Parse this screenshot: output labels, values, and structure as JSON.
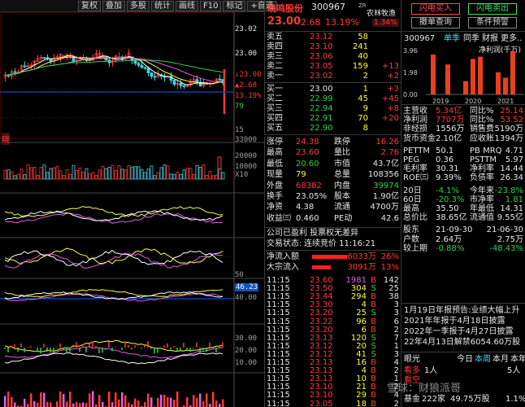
{
  "toolbar": {
    "buttons": [
      "复权",
      "叠加",
      "多股",
      "统计",
      "画线",
      "F10",
      "标记"
    ],
    "auto_label": "+自选"
  },
  "chart": {
    "axis_labels": [
      "23.02",
      "23.00",
      "13.19%",
      "79",
      "15",
      "33000",
      "20000",
      "10000",
      "X10",
      "50",
      "46.23",
      "40.00",
      "30.00",
      "20.00",
      "10.00"
    ],
    "price_marker": "↓23.00",
    "chg_marker": "▲2.68",
    "side_label": "晓"
  },
  "stock": {
    "name": "晓鸣股份",
    "code": "300967",
    "tag": "ZR",
    "sector": "农林牧渔",
    "sector_pct": "1.34%",
    "price": "23.00",
    "change": "2.68",
    "change_pct": "13.19%"
  },
  "order_book": {
    "asks": [
      {
        "label": "卖五",
        "price": "23.12",
        "vol": "58",
        "chg": ""
      },
      {
        "label": "卖四",
        "price": "23.10",
        "vol": "241",
        "chg": ""
      },
      {
        "label": "卖三",
        "price": "23.06",
        "vol": "40",
        "chg": ""
      },
      {
        "label": "卖二",
        "price": "23.05",
        "vol": "159",
        "chg": "+13"
      },
      {
        "label": "卖一",
        "price": "23.02",
        "vol": "2",
        "chg": "+2"
      }
    ],
    "bids": [
      {
        "label": "买一",
        "price": "23.00",
        "vol": "1",
        "chg": "+3"
      },
      {
        "label": "买二",
        "price": "22.99",
        "vol": "45",
        "chg": "+45"
      },
      {
        "label": "买三",
        "price": "22.94",
        "vol": "9",
        "chg": "+8"
      },
      {
        "label": "买四",
        "price": "22.91",
        "vol": "70",
        "chg": "+20"
      },
      {
        "label": "买五",
        "price": "22.90",
        "vol": "8",
        "chg": ""
      }
    ]
  },
  "quote_stats": [
    [
      "涨停",
      "24.38",
      "跌停",
      "16.26"
    ],
    [
      "最高",
      "23.60",
      "量比",
      "2.76"
    ],
    [
      "最低",
      "20.60",
      "市值",
      "43.7亿"
    ],
    [
      "现量",
      "79",
      "总量",
      "108356"
    ],
    [
      "外盘",
      "68382",
      "内盘",
      "39974"
    ],
    [
      "换手",
      "23.05%",
      "股本",
      "1.90亿"
    ],
    [
      "净资",
      "4.38",
      "流通",
      "4700万"
    ],
    [
      "收益㈢",
      "0.460",
      "PE动",
      "42.6"
    ]
  ],
  "status": {
    "line1": "公司已盈利 投票权无差异",
    "line2_label": "交易状态:",
    "line2_value": "连续竞价 11:16:21"
  },
  "flows": [
    {
      "label": "净流入额",
      "value": "6033万",
      "pct": "26%",
      "bar": 0.85
    },
    {
      "label": "大宗流入",
      "value": "3091万",
      "pct": "13%",
      "bar": 0.45
    }
  ],
  "ticks": [
    {
      "time": "11:15",
      "price": "23.60",
      "vol": "1981",
      "dir": "B",
      "n": "142"
    },
    {
      "time": "11:15",
      "price": "23.50",
      "vol": "304",
      "dir": "S",
      "n": "25"
    },
    {
      "time": "11:15",
      "price": "23.44",
      "vol": "294",
      "dir": "B",
      "n": "38"
    },
    {
      "time": "11:15",
      "price": "23.30",
      "vol": "4",
      "dir": "B",
      "n": "3"
    },
    {
      "time": "11:15",
      "price": "23.20",
      "vol": "25",
      "dir": "S",
      "n": "3"
    },
    {
      "time": "11:15",
      "price": "23.22",
      "vol": "96",
      "dir": "B",
      "n": "6"
    },
    {
      "time": "11:15",
      "price": "23.20",
      "vol": "6",
      "dir": "B",
      "n": "2"
    },
    {
      "time": "11:15",
      "price": "23.13",
      "vol": "120",
      "dir": "S",
      "n": "7"
    },
    {
      "time": "11:15",
      "price": "23.12",
      "vol": "20",
      "dir": "S",
      "n": "1"
    },
    {
      "time": "11:15",
      "price": "23.12",
      "vol": "41",
      "dir": "S",
      "n": "3"
    },
    {
      "time": "11:15",
      "price": "23.13",
      "vol": "16",
      "dir": "B",
      "n": "4"
    },
    {
      "time": "11:15",
      "price": "23.13",
      "vol": "4",
      "dir": "B",
      "n": "2"
    },
    {
      "time": "11:15",
      "price": "23.13",
      "vol": "10",
      "dir": "B",
      "n": "1"
    },
    {
      "time": "11:15",
      "price": "23.10",
      "vol": "21",
      "dir": "B",
      "n": "2"
    },
    {
      "time": "11:15",
      "price": "23.10",
      "vol": "29",
      "dir": "B",
      "n": "4"
    },
    {
      "time": "11:15",
      "price": "23.05",
      "vol": "18",
      "dir": "B",
      "n": "2"
    }
  ],
  "right": {
    "buttons": {
      "buy": "闪电买入",
      "sell": "闪电卖出",
      "cancel": "撤单查询",
      "cond": "条件预警"
    },
    "code": "300967",
    "tabs": [
      "单季",
      "同季",
      "财报",
      "更多.."
    ],
    "chart_title": "净利润(千万)",
    "fundamentals": [
      [
        "主营收",
        "5.34亿",
        "同比%",
        "25.14"
      ],
      [
        "净利润",
        "7707万",
        "同比%",
        "53.52"
      ],
      [
        "非经损",
        "1556万",
        "销售费",
        "5190万"
      ],
      [
        "货币资金",
        "2.10亿",
        "应收账",
        "1394万"
      ],
      [
        "PETTM",
        "50.1",
        "PB MRQ",
        "4.71"
      ],
      [
        "PEG",
        "0.36",
        "PSTTM",
        "5.97"
      ],
      [
        "毛利率",
        "30.31",
        "净利率",
        "14.44"
      ],
      [
        "ROE㈢",
        "9.39%",
        "负债率",
        "26.34"
      ],
      [
        "20日",
        "-4.1%",
        "今年来",
        "-23.8%"
      ],
      [
        "60日",
        "-20.3%",
        "市净率",
        "1.81"
      ],
      [
        "最高",
        "35.50",
        "年最低",
        "14.31"
      ],
      [
        "总价比",
        "38.65亿",
        "流通值",
        "9.55亿"
      ],
      [
        "股东",
        "21-09-30",
        "",
        "21-06-30"
      ],
      [
        "户数",
        "2.64万",
        "",
        "2.75万"
      ],
      [
        "较上期",
        "-0.88%",
        "",
        "-48.43%"
      ]
    ],
    "news": [
      "1月19日年报预告:业绩大幅上升",
      "2021年年报于4月18日披露",
      "2022年一季报于4月27日披露",
      "22年4月13日解禁6054.60万股"
    ],
    "bottom": {
      "label": "眼光",
      "tabs": [
        "今日",
        "本周",
        "本月",
        "本年"
      ],
      "row1_label": "看多",
      "row1_value": "1人",
      "row1_right": "5人",
      "row2_label": "看空",
      "base_label": "基金",
      "base_value": "222家",
      "base_amt": "49.75万股",
      "base_pct": "1.1%"
    },
    "watermark": "雪球：财狼派哥"
  },
  "chart_data": {
    "type": "bar",
    "title": "净利润(千万)",
    "categories": [
      "2019",
      "2020",
      "2021"
    ],
    "series": [
      {
        "values": [
          3.6,
          1.2,
          2.0
        ]
      },
      {
        "values": [
          0,
          3.2,
          1.5
        ]
      },
      {
        "values": [
          2.7,
          3.4,
          3.9
        ]
      }
    ],
    "ylabel": "",
    "ylim": [
      0,
      3.96
    ],
    "ytick_labels": [
      "3.96",
      "1.98",
      "0.00"
    ],
    "xlabel": ""
  }
}
